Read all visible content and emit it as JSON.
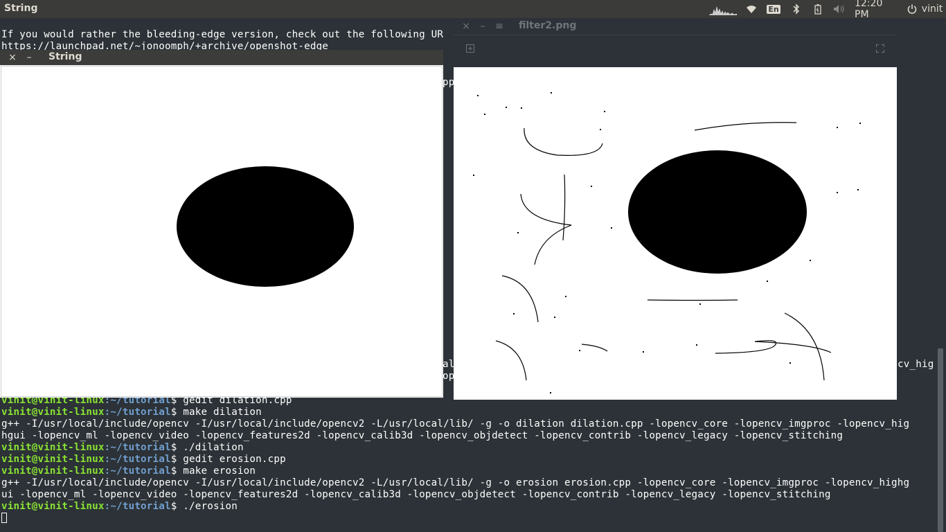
{
  "panel": {
    "app_name": "String",
    "keyboard_layout": "En",
    "time": "12:20 PM",
    "user": "vinit",
    "icons": [
      "system-monitor-icon",
      "wifi-icon",
      "keyboard-icon",
      "bluetooth-icon",
      "battery-icon",
      "volume-icon",
      "power-icon"
    ]
  },
  "terminal": {
    "lines_top": [
      "If you would rather the bleeding-edge version, check out the following UR",
      "https://launchpad.net/~jonoomph/+archive/openshot-edge"
    ],
    "fragments": {
      "pp": "pp",
      "al": "al",
      "op": "op",
      "cv_hig": "cv_hig"
    },
    "user_host": "vinit@vinit-linux",
    "path": ":~/tutorial",
    "history": [
      {
        "type": "prompt",
        "cmd": "$ gedit dilation.cpp"
      },
      {
        "type": "prompt",
        "cmd": "$ make dilation"
      },
      {
        "type": "out",
        "text": "g++ -I/usr/local/include/opencv -I/usr/local/include/opencv2 -L/usr/local/lib/ -g -o dilation dilation.cpp -lopencv_core -lopencv_imgproc -lopencv_hig"
      },
      {
        "type": "out",
        "text": "hgui -lopencv_ml -lopencv_video -lopencv_features2d -lopencv_calib3d -lopencv_objdetect -lopencv_contrib -lopencv_legacy -lopencv_stitching"
      },
      {
        "type": "prompt",
        "cmd": "$ ./dilation"
      },
      {
        "type": "prompt",
        "cmd": "$ gedit erosion.cpp"
      },
      {
        "type": "prompt",
        "cmd": "$ make erosion"
      },
      {
        "type": "out",
        "text": "g++ -I/usr/local/include/opencv -I/usr/local/include/opencv2 -L/usr/local/lib/ -g -o erosion erosion.cpp -lopencv_core -lopencv_imgproc -lopencv_highg"
      },
      {
        "type": "out",
        "text": "ui -lopencv_ml -lopencv_video -lopencv_features2d -lopencv_calib3d -lopencv_objdetect -lopencv_contrib -lopencv_legacy -lopencv_stitching"
      },
      {
        "type": "prompt",
        "cmd": "$ ./erosion"
      }
    ]
  },
  "window_string": {
    "title": "String",
    "close": "×",
    "minimize": "–"
  },
  "window_filter": {
    "title": "filter2.png",
    "close": "×",
    "minimize": "–",
    "menu": "≡"
  },
  "colors": {
    "terminal_bg": "#2c3237",
    "prompt_user": "#8ae234",
    "prompt_path": "#729fcf",
    "panel_bg": "#3b3b39"
  }
}
